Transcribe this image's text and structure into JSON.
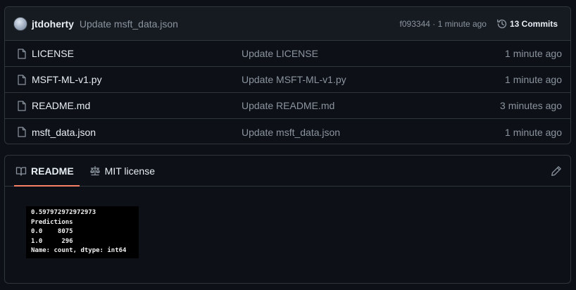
{
  "commit": {
    "author": "jtdoherty",
    "message": "Update msft_data.json",
    "meta": "f093344 · 1 minute ago",
    "history_label": "13 Commits"
  },
  "files": [
    {
      "name": "LICENSE",
      "commit": "Update LICENSE",
      "age": "1 minute ago"
    },
    {
      "name": "MSFT-ML-v1.py",
      "commit": "Update MSFT-ML-v1.py",
      "age": "1 minute ago"
    },
    {
      "name": "README.md",
      "commit": "Update README.md",
      "age": "3 minutes ago"
    },
    {
      "name": "msft_data.json",
      "commit": "Update msft_data.json",
      "age": "1 minute ago"
    }
  ],
  "readme": {
    "tabs": [
      {
        "label": "README",
        "icon": "book-icon"
      },
      {
        "label": "MIT license",
        "icon": "law-icon"
      }
    ],
    "edit_icon": "pencil-icon",
    "output_lines": [
      "0.597972972972973",
      "Predictions",
      "0.0    8075",
      "1.0     296",
      "Name: count, dtype: int64"
    ]
  },
  "colors": {
    "background": "#0d1117",
    "border": "#30363d",
    "header_bg": "#161b22",
    "muted_text": "#8b949e",
    "tab_underline": "#f78166"
  }
}
